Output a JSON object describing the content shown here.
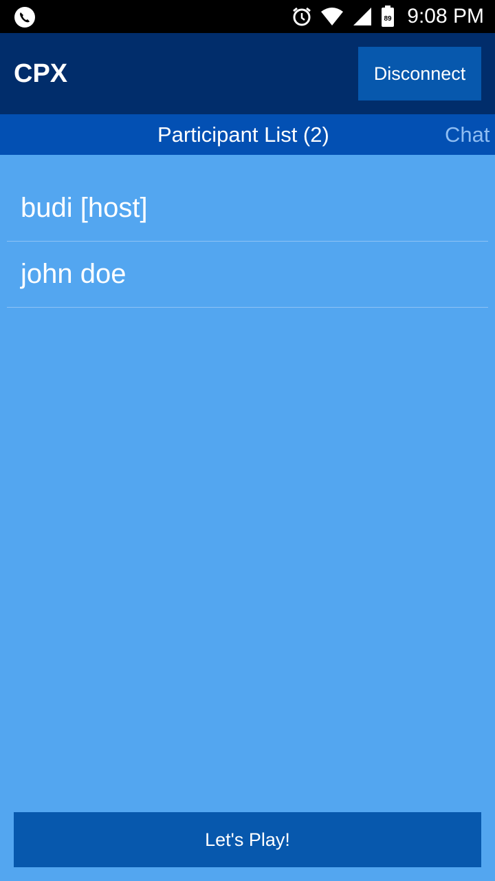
{
  "status_bar": {
    "time": "9:08 PM",
    "battery_level": "89",
    "icons": [
      "phone-call-icon",
      "alarm-icon",
      "wifi-icon",
      "signal-icon",
      "battery-icon"
    ]
  },
  "app_bar": {
    "title": "CPX",
    "disconnect_label": "Disconnect"
  },
  "tabs": [
    {
      "label": "Participant List (2)",
      "selected": true
    },
    {
      "label": "Chat",
      "selected": false
    }
  ],
  "participants": [
    {
      "name": "budi [host]"
    },
    {
      "name": "john doe"
    }
  ],
  "footer": {
    "play_label": "Let's Play!"
  },
  "colors": {
    "status_bar": "#000000",
    "app_bar": "#012d6b",
    "tab_bar": "#0350b3",
    "content_bg": "#53a6f0",
    "button": "#0758ad",
    "inactive_tab_text": "#8fbdf2"
  }
}
